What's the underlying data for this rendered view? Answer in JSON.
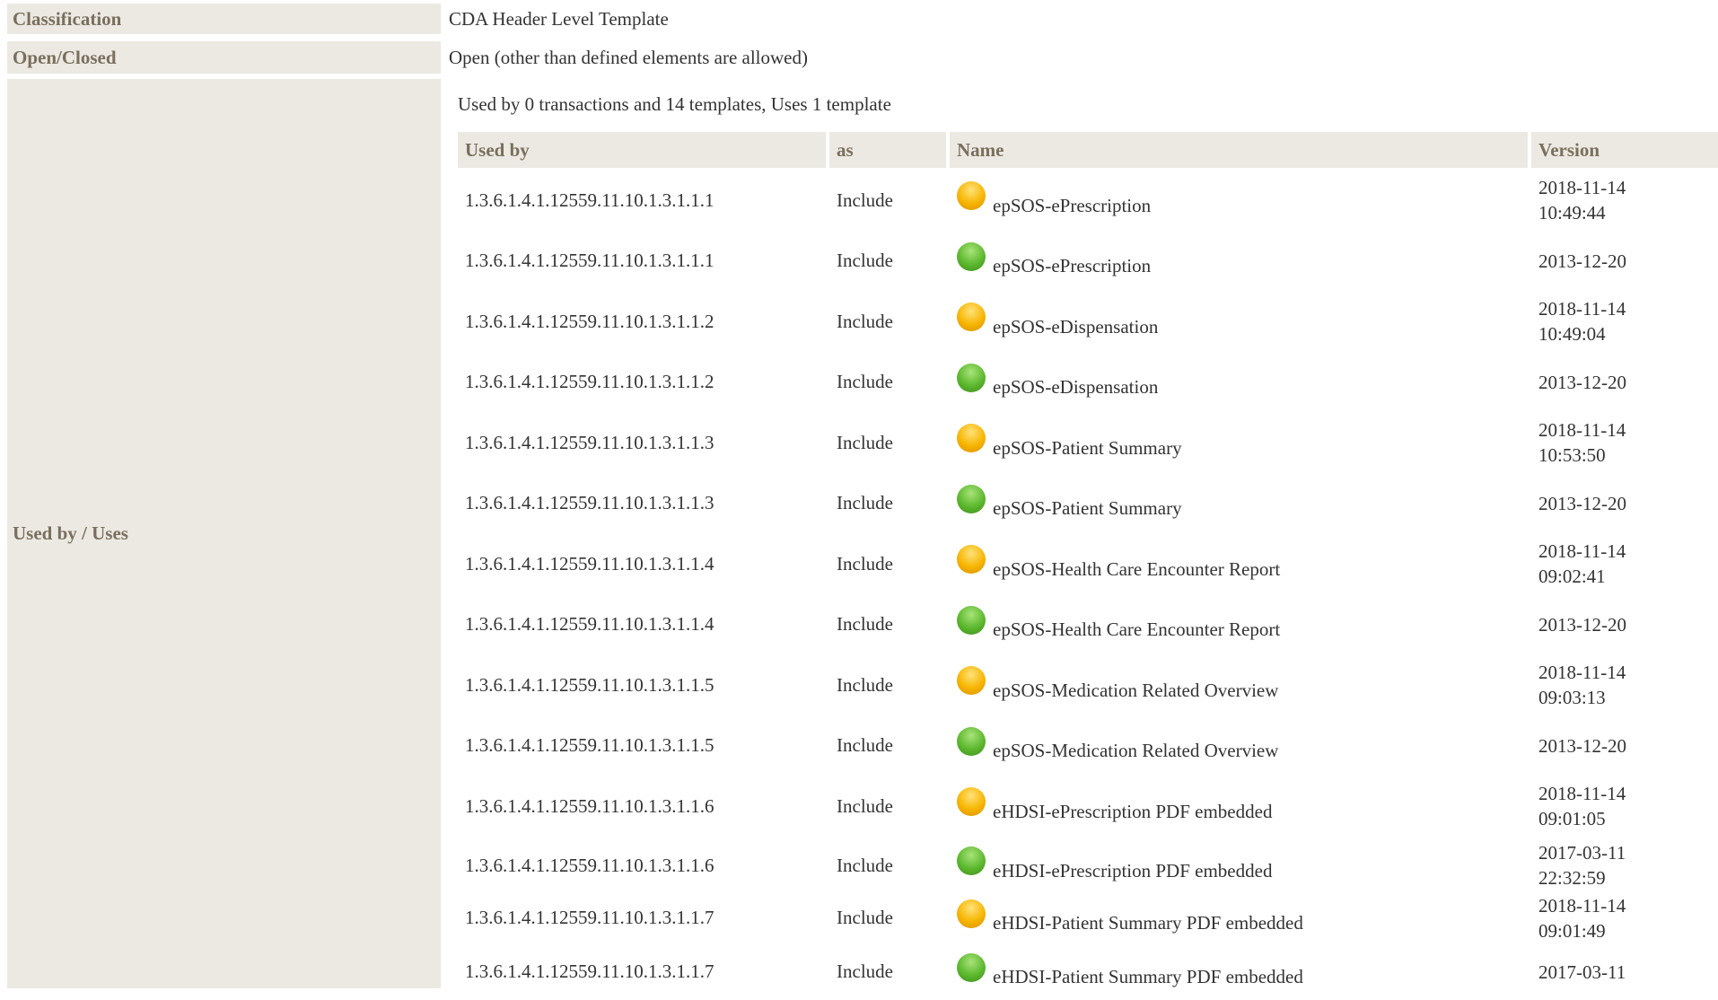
{
  "classification": {
    "label": "Classification",
    "value": "CDA Header Level Template"
  },
  "open_closed": {
    "label": "Open/Closed",
    "value": "Open (other than defined elements are allowed)"
  },
  "used_by_uses": {
    "label": "Used by / Uses",
    "summary": "Used by 0 transactions and 14 templates, Uses 1 template",
    "headers": {
      "used_by": "Used by",
      "as": "as",
      "name": "Name",
      "version": "Version"
    },
    "rows": [
      {
        "id": "1.3.6.1.4.1.12559.11.10.1.3.1.1.1",
        "as": "Include",
        "status": "yellow",
        "name": "epSOS-ePrescription",
        "version_date": "2018-11-14",
        "version_time": "10:49:44"
      },
      {
        "id": "1.3.6.1.4.1.12559.11.10.1.3.1.1.1",
        "as": "Include",
        "status": "green",
        "name": "epSOS-ePrescription",
        "version_date": "2013-12-20",
        "version_time": ""
      },
      {
        "id": "1.3.6.1.4.1.12559.11.10.1.3.1.1.2",
        "as": "Include",
        "status": "yellow",
        "name": "epSOS-eDispensation",
        "version_date": "2018-11-14",
        "version_time": "10:49:04"
      },
      {
        "id": "1.3.6.1.4.1.12559.11.10.1.3.1.1.2",
        "as": "Include",
        "status": "green",
        "name": "epSOS-eDispensation",
        "version_date": "2013-12-20",
        "version_time": ""
      },
      {
        "id": "1.3.6.1.4.1.12559.11.10.1.3.1.1.3",
        "as": "Include",
        "status": "yellow",
        "name": "epSOS-Patient Summary",
        "version_date": "2018-11-14",
        "version_time": "10:53:50"
      },
      {
        "id": "1.3.6.1.4.1.12559.11.10.1.3.1.1.3",
        "as": "Include",
        "status": "green",
        "name": "epSOS-Patient Summary",
        "version_date": "2013-12-20",
        "version_time": ""
      },
      {
        "id": "1.3.6.1.4.1.12559.11.10.1.3.1.1.4",
        "as": "Include",
        "status": "yellow",
        "name": "epSOS-Health Care Encounter Report",
        "version_date": "2018-11-14",
        "version_time": "09:02:41"
      },
      {
        "id": "1.3.6.1.4.1.12559.11.10.1.3.1.1.4",
        "as": "Include",
        "status": "green",
        "name": "epSOS-Health Care Encounter Report",
        "version_date": "2013-12-20",
        "version_time": ""
      },
      {
        "id": "1.3.6.1.4.1.12559.11.10.1.3.1.1.5",
        "as": "Include",
        "status": "yellow",
        "name": "epSOS-Medication Related Overview",
        "version_date": "2018-11-14",
        "version_time": "09:03:13"
      },
      {
        "id": "1.3.6.1.4.1.12559.11.10.1.3.1.1.5",
        "as": "Include",
        "status": "green",
        "name": "epSOS-Medication Related Overview",
        "version_date": "2013-12-20",
        "version_time": ""
      },
      {
        "id": "1.3.6.1.4.1.12559.11.10.1.3.1.1.6",
        "as": "Include",
        "status": "yellow",
        "name": "eHDSI-ePrescription PDF embedded",
        "version_date": "2018-11-14",
        "version_time": "09:01:05"
      },
      {
        "id": "1.3.6.1.4.1.12559.11.10.1.3.1.1.6",
        "as": "Include",
        "status": "green",
        "name": "eHDSI-ePrescription PDF embedded",
        "version_date": "2017-03-11",
        "version_time": "22:32:59"
      },
      {
        "id": "1.3.6.1.4.1.12559.11.10.1.3.1.1.7",
        "as": "Include",
        "status": "yellow",
        "name": "eHDSI-Patient Summary PDF embedded",
        "version_date": "2018-11-14",
        "version_time": "09:01:49"
      },
      {
        "id": "1.3.6.1.4.1.12559.11.10.1.3.1.1.7",
        "as": "Include",
        "status": "green",
        "name": "eHDSI-Patient Summary PDF embedded",
        "version_date": "2017-03-11",
        "version_time": ""
      }
    ]
  }
}
